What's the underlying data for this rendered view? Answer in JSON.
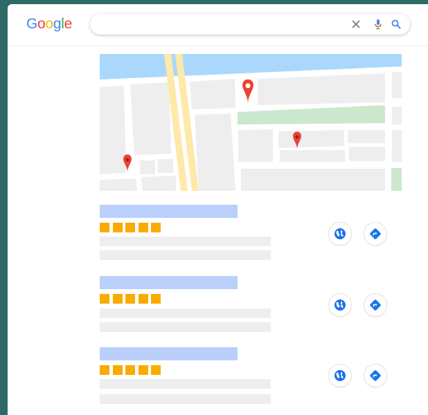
{
  "header": {
    "logo_letters": [
      {
        "char": "G",
        "color": "#4285f4"
      },
      {
        "char": "o",
        "color": "#ea4335"
      },
      {
        "char": "o",
        "color": "#fbbc05"
      },
      {
        "char": "g",
        "color": "#4285f4"
      },
      {
        "char": "l",
        "color": "#34a853"
      },
      {
        "char": "e",
        "color": "#ea4335"
      }
    ],
    "search": {
      "value": "",
      "placeholder": "",
      "icons": [
        "close-icon",
        "microphone-icon",
        "search-icon"
      ]
    }
  },
  "map": {
    "pins": [
      "map-pin",
      "map-pin",
      "map-pin"
    ],
    "colors": {
      "water": "#aad8fc",
      "park": "#cbe8cd",
      "road": "#ffe9a8",
      "block": "#eeeeee",
      "pin": "#ea4335"
    }
  },
  "results": [
    {
      "rating": 5,
      "actions": [
        "website-icon",
        "directions-icon"
      ]
    },
    {
      "rating": 5,
      "actions": [
        "website-icon",
        "directions-icon"
      ]
    },
    {
      "rating": 5,
      "actions": [
        "website-icon",
        "directions-icon"
      ]
    }
  ],
  "colors": {
    "background": "#2e6a66",
    "title_placeholder": "#bad0fb",
    "star": "#f9ab00",
    "text_placeholder": "#eeeeee",
    "action_icon": "#1a73e8"
  }
}
